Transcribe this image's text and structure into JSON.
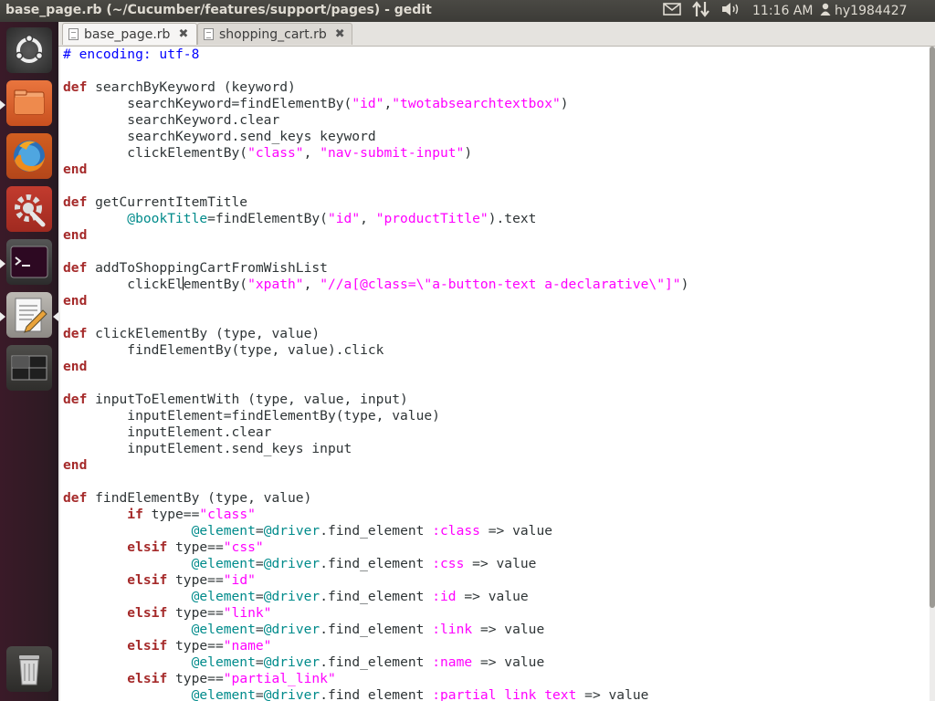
{
  "window_title": "base_page.rb (~/Cucumber/features/support/pages) - gedit",
  "tray": {
    "mail_icon": "envelope-icon",
    "network_icon": "network-arrows-icon",
    "volume_icon": "speaker-icon",
    "time": "11:16 AM",
    "user_icon": "person-icon",
    "user": "hy1984427"
  },
  "launcher": {
    "items": [
      "ubuntu-dash",
      "files",
      "firefox",
      "system-settings",
      "terminal",
      "text-editor",
      "workspace-switcher",
      "trash"
    ]
  },
  "tabs": [
    {
      "label": "base_page.rb",
      "active": true
    },
    {
      "label": "shopping_cart.rb",
      "active": false
    }
  ],
  "colors": {
    "keyword": "#a52a2a",
    "string": "#ff00ff",
    "instance_variable": "#008b8b",
    "comment": "#0000ff"
  },
  "code": [
    [
      {
        "t": "# encoding: utf-8",
        "c": "comment"
      }
    ],
    [],
    [
      {
        "t": "def",
        "c": "kw"
      },
      {
        "t": " searchByKeyword (keyword)"
      }
    ],
    [
      {
        "t": "        searchKeyword=findElementBy("
      },
      {
        "t": "\"id\"",
        "c": "str"
      },
      {
        "t": ","
      },
      {
        "t": "\"twotabsearchtextbox\"",
        "c": "str"
      },
      {
        "t": ")"
      }
    ],
    [
      {
        "t": "        searchKeyword.clear"
      }
    ],
    [
      {
        "t": "        searchKeyword.send_keys keyword"
      }
    ],
    [
      {
        "t": "        clickElementBy("
      },
      {
        "t": "\"class\"",
        "c": "str"
      },
      {
        "t": ", "
      },
      {
        "t": "\"nav-submit-input\"",
        "c": "str"
      },
      {
        "t": ")"
      }
    ],
    [
      {
        "t": "end",
        "c": "kw"
      }
    ],
    [],
    [
      {
        "t": "def",
        "c": "kw"
      },
      {
        "t": " getCurrentItemTitle"
      }
    ],
    [
      {
        "t": "        "
      },
      {
        "t": "@bookTitle",
        "c": "ivar"
      },
      {
        "t": "=findElementBy("
      },
      {
        "t": "\"id\"",
        "c": "str"
      },
      {
        "t": ", "
      },
      {
        "t": "\"productTitle\"",
        "c": "str"
      },
      {
        "t": ").text"
      }
    ],
    [
      {
        "t": "end",
        "c": "kw"
      }
    ],
    [],
    [
      {
        "t": "def",
        "c": "kw"
      },
      {
        "t": " addToShoppingCartFromWishList"
      }
    ],
    [
      {
        "t": "        clickEl"
      },
      {
        "t": "",
        "c": "caret"
      },
      {
        "t": "ementBy("
      },
      {
        "t": "\"xpath\"",
        "c": "str"
      },
      {
        "t": ", "
      },
      {
        "t": "\"//a[@class=\\\"a-button-text a-declarative\\\"]\"",
        "c": "str"
      },
      {
        "t": ")"
      }
    ],
    [
      {
        "t": "end",
        "c": "kw"
      }
    ],
    [],
    [
      {
        "t": "def",
        "c": "kw"
      },
      {
        "t": " clickElementBy (type, value)"
      }
    ],
    [
      {
        "t": "        findElementBy(type, value).click"
      }
    ],
    [
      {
        "t": "end",
        "c": "kw"
      }
    ],
    [],
    [
      {
        "t": "def",
        "c": "kw"
      },
      {
        "t": " inputToElementWith (type, value, input)"
      }
    ],
    [
      {
        "t": "        inputElement=findElementBy(type, value)"
      }
    ],
    [
      {
        "t": "        inputElement.clear"
      }
    ],
    [
      {
        "t": "        inputElement.send_keys input"
      }
    ],
    [
      {
        "t": "end",
        "c": "kw"
      }
    ],
    [],
    [
      {
        "t": "def",
        "c": "kw"
      },
      {
        "t": " findElementBy (type, value)"
      }
    ],
    [
      {
        "t": "        "
      },
      {
        "t": "if",
        "c": "kw"
      },
      {
        "t": " type=="
      },
      {
        "t": "\"class\"",
        "c": "str"
      }
    ],
    [
      {
        "t": "                "
      },
      {
        "t": "@element",
        "c": "ivar"
      },
      {
        "t": "="
      },
      {
        "t": "@driver",
        "c": "ivar"
      },
      {
        "t": ".find_element "
      },
      {
        "t": ":class",
        "c": "sym"
      },
      {
        "t": " => value"
      }
    ],
    [
      {
        "t": "        "
      },
      {
        "t": "elsif",
        "c": "kw"
      },
      {
        "t": " type=="
      },
      {
        "t": "\"css\"",
        "c": "str"
      }
    ],
    [
      {
        "t": "                "
      },
      {
        "t": "@element",
        "c": "ivar"
      },
      {
        "t": "="
      },
      {
        "t": "@driver",
        "c": "ivar"
      },
      {
        "t": ".find_element "
      },
      {
        "t": ":css",
        "c": "sym"
      },
      {
        "t": " => value"
      }
    ],
    [
      {
        "t": "        "
      },
      {
        "t": "elsif",
        "c": "kw"
      },
      {
        "t": " type=="
      },
      {
        "t": "\"id\"",
        "c": "str"
      }
    ],
    [
      {
        "t": "                "
      },
      {
        "t": "@element",
        "c": "ivar"
      },
      {
        "t": "="
      },
      {
        "t": "@driver",
        "c": "ivar"
      },
      {
        "t": ".find_element "
      },
      {
        "t": ":id",
        "c": "sym"
      },
      {
        "t": " => value"
      }
    ],
    [
      {
        "t": "        "
      },
      {
        "t": "elsif",
        "c": "kw"
      },
      {
        "t": " type=="
      },
      {
        "t": "\"link\"",
        "c": "str"
      }
    ],
    [
      {
        "t": "                "
      },
      {
        "t": "@element",
        "c": "ivar"
      },
      {
        "t": "="
      },
      {
        "t": "@driver",
        "c": "ivar"
      },
      {
        "t": ".find_element "
      },
      {
        "t": ":link",
        "c": "sym"
      },
      {
        "t": " => value"
      }
    ],
    [
      {
        "t": "        "
      },
      {
        "t": "elsif",
        "c": "kw"
      },
      {
        "t": " type=="
      },
      {
        "t": "\"name\"",
        "c": "str"
      }
    ],
    [
      {
        "t": "                "
      },
      {
        "t": "@element",
        "c": "ivar"
      },
      {
        "t": "="
      },
      {
        "t": "@driver",
        "c": "ivar"
      },
      {
        "t": ".find_element "
      },
      {
        "t": ":name",
        "c": "sym"
      },
      {
        "t": " => value"
      }
    ],
    [
      {
        "t": "        "
      },
      {
        "t": "elsif",
        "c": "kw"
      },
      {
        "t": " type=="
      },
      {
        "t": "\"partial_link\"",
        "c": "str"
      }
    ],
    [
      {
        "t": "                "
      },
      {
        "t": "@element",
        "c": "ivar"
      },
      {
        "t": "="
      },
      {
        "t": "@driver",
        "c": "ivar"
      },
      {
        "t": ".find_element "
      },
      {
        "t": ":partial_link_text",
        "c": "sym"
      },
      {
        "t": " => value"
      }
    ]
  ]
}
